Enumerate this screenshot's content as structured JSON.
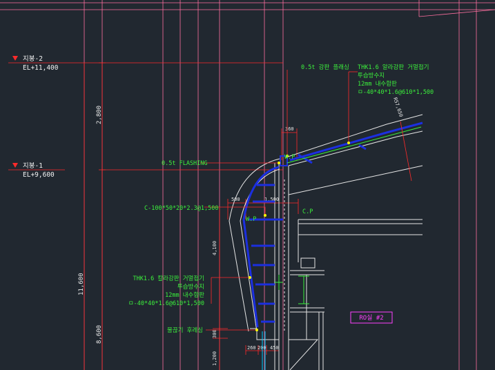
{
  "levels": [
    {
      "name": "지붕-2",
      "elevation": "EL+11,400"
    },
    {
      "name": "지붕-1",
      "elevation": "EL+9,600"
    }
  ],
  "callouts": {
    "top_note": "0.5t 강판 플래싱",
    "top_spec": [
      "THK1.6 알라강판 거멀접기",
      "투습방수지",
      "12mm 내수합판",
      "ㅁ-40*40*1.6@610*1,500"
    ],
    "flashing": "0.5t FLASHING",
    "c_channel": "C-100*50*20*2.3@1,500",
    "mid_spec": [
      "THK1.6 칼라강판 거멀접기",
      "투습방수지",
      "12mm 내수합판",
      "ㅁ-40*40*1.6@610*1,500"
    ],
    "gutter": "물끊기 후레싱",
    "wp_top": "W.P",
    "wp_mid": "W.P",
    "cp": "C.P"
  },
  "dimensions": {
    "d360": "360",
    "d500": "500",
    "d1500": "1,500",
    "d2800": "2,800",
    "d4100": "4,100",
    "d11600": "11,600",
    "d8600": "8,600",
    "d300": "300",
    "d1200": "1,200",
    "d260": "260",
    "d200": "200",
    "d450": "450",
    "slope": "R57,650"
  },
  "room_tag": "RO실 #2",
  "colors": {
    "background": "#212830",
    "dim_line": "#ff2a2a",
    "grid_line": "#ff6fa0",
    "member": "#1b2fe0",
    "note": "#3cf03c",
    "outline": "#e6e6e6",
    "tag": "#ff40ff"
  }
}
